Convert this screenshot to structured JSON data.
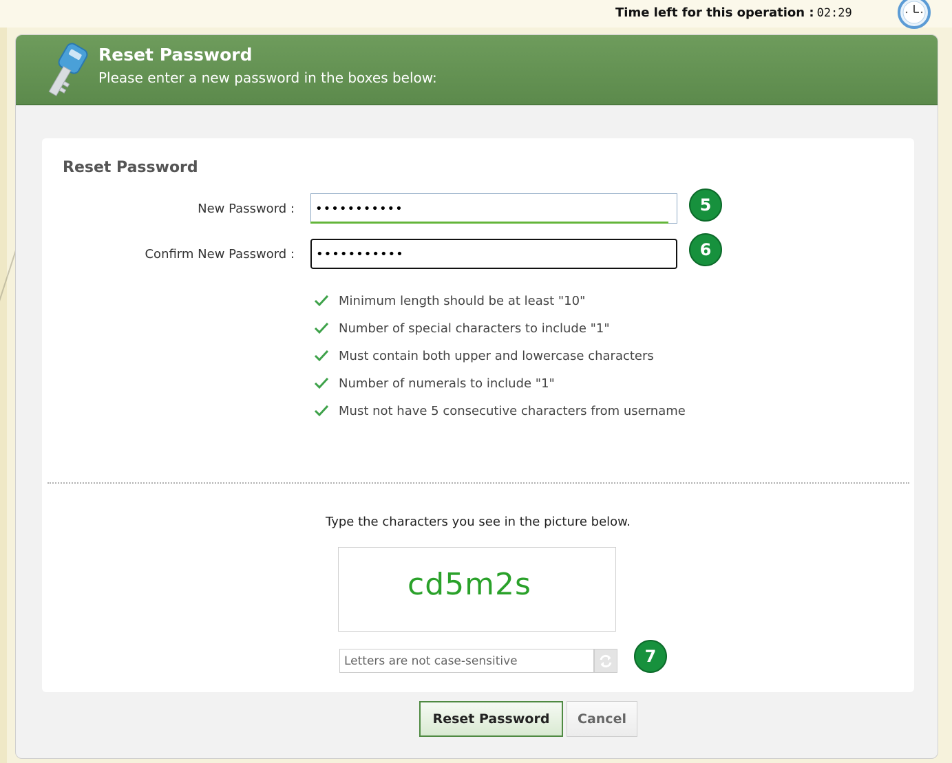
{
  "timer": {
    "label": "Time left for this operation :",
    "value": "02:29"
  },
  "header": {
    "title": "Reset Password",
    "subtitle": "Please enter a new password in the boxes below:"
  },
  "form": {
    "title": "Reset Password",
    "new_password_label": "New Password :",
    "new_password_value": "•••••••••••",
    "confirm_password_label": "Confirm New Password :",
    "confirm_password_value": "•••••••••••"
  },
  "rules": [
    "Minimum length should be at least \"10\"",
    "Number of special characters to include \"1\"",
    "Must contain both upper and lowercase characters",
    "Number of numerals to include \"1\"",
    "Must not have 5 consecutive characters from username"
  ],
  "captcha": {
    "prompt": "Type the characters you see in the picture below.",
    "image_text": "cd5m2s",
    "input_placeholder": "Letters are not case-sensitive"
  },
  "buttons": {
    "reset": "Reset Password",
    "cancel": "Cancel"
  },
  "badges": [
    "5",
    "6",
    "7"
  ],
  "colors": {
    "header_green": "#5c8a4c",
    "badge_green": "#17913d",
    "check_green": "#3ea24a",
    "captcha_green": "#2aa12a"
  }
}
